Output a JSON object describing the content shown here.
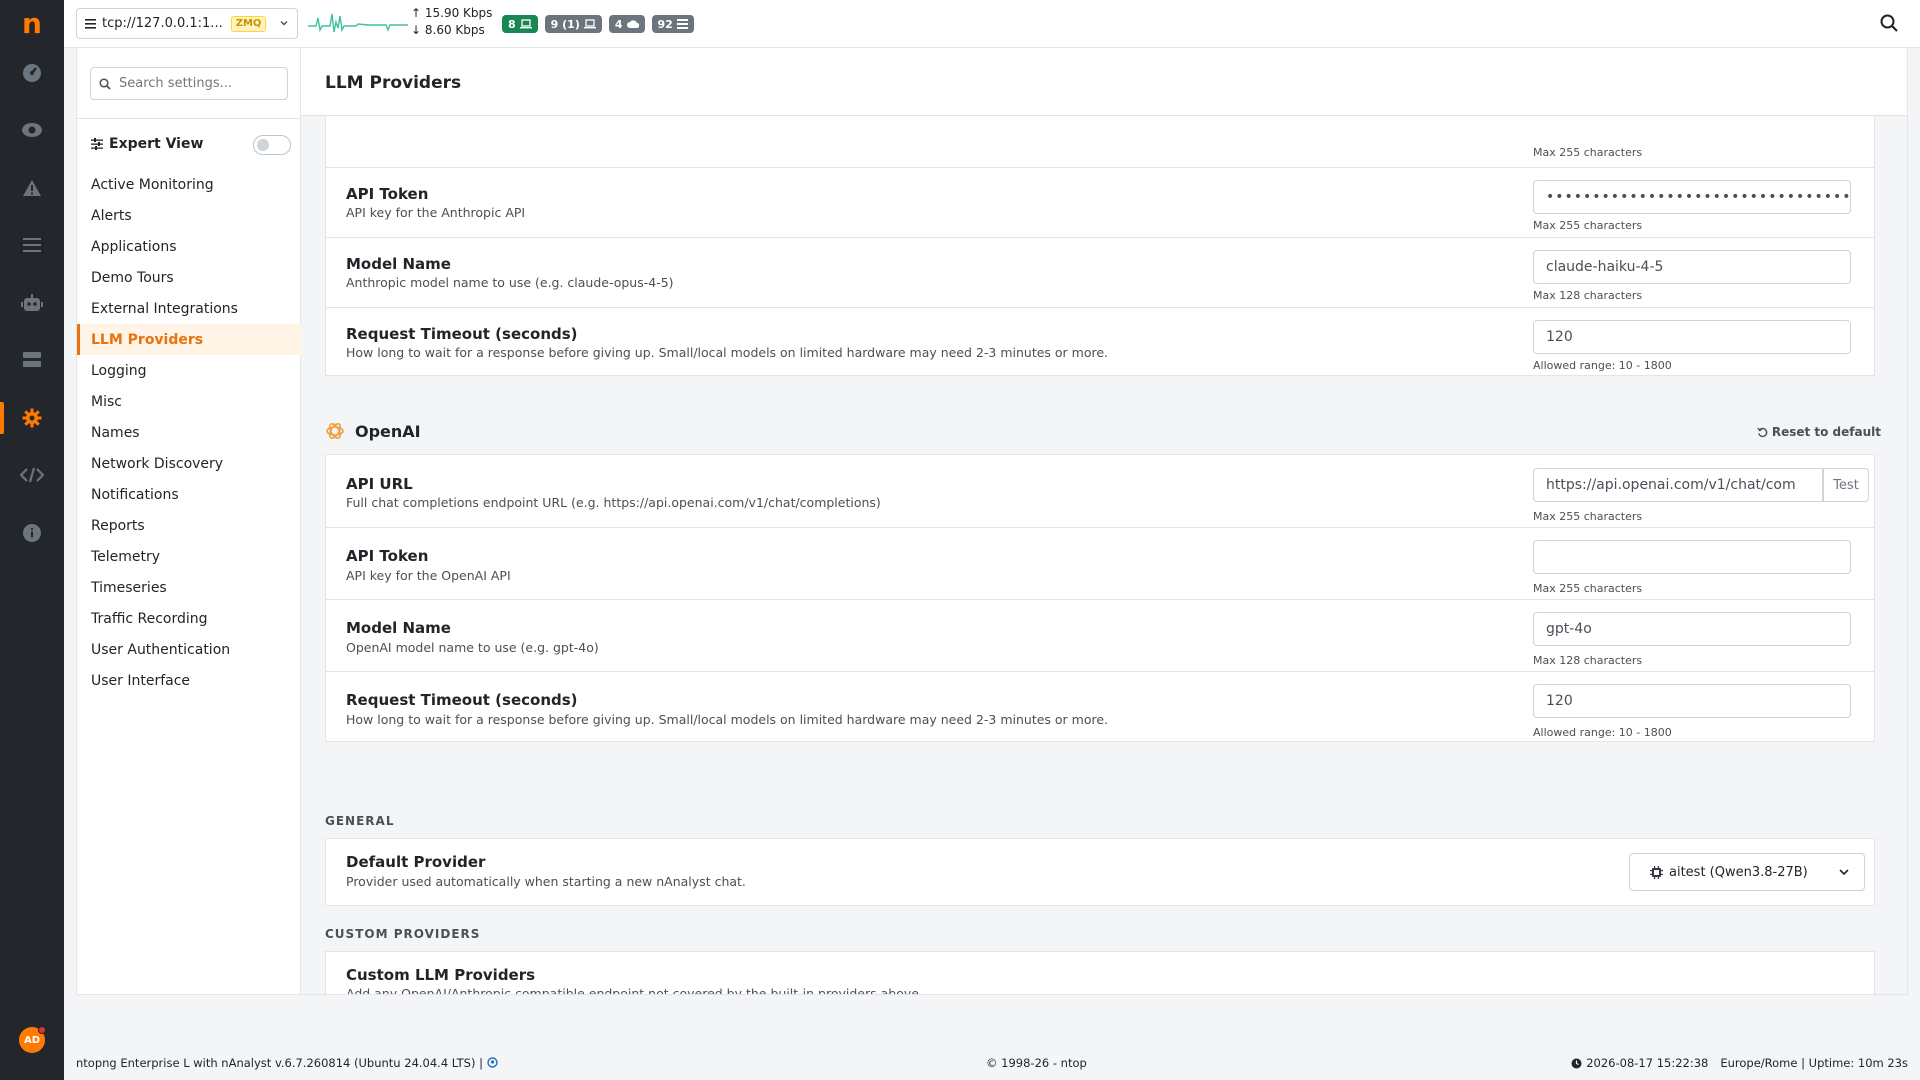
{
  "app": {
    "logo": "n"
  },
  "rail": {
    "items": [
      {
        "name": "dashboard-icon"
      },
      {
        "name": "eye-icon"
      },
      {
        "name": "alert-triangle-icon"
      },
      {
        "name": "list-icon"
      },
      {
        "name": "robot-icon"
      },
      {
        "name": "server-icon"
      },
      {
        "name": "gear-icon"
      },
      {
        "name": "code-icon"
      },
      {
        "name": "info-icon"
      }
    ],
    "avatar": "AD"
  },
  "topbar": {
    "interface": "tcp://127.0.0.1:1...",
    "interface_tag": "ZMQ",
    "upload_rate": "15.90 Kbps",
    "download_rate": "8.60 Kbps",
    "badges": [
      "8",
      "9 (1)",
      "4",
      "92"
    ]
  },
  "sidebar": {
    "search_placeholder": "Search settings...",
    "expert_view": "Expert View",
    "items": [
      "Active Monitoring",
      "Alerts",
      "Applications",
      "Demo Tours",
      "External Integrations",
      "LLM Providers",
      "Logging",
      "Misc",
      "Names",
      "Network Discovery",
      "Notifications",
      "Reports",
      "Telemetry",
      "Timeseries",
      "Traffic Recording",
      "User Authentication",
      "User Interface"
    ],
    "active": "LLM Providers"
  },
  "page": {
    "title": "LLM Providers"
  },
  "anthropic": {
    "prev_hint": "Max 255 characters",
    "token": {
      "title": "API Token",
      "desc": "API key for the Anthropic API",
      "value": "••••••••••••••••••••••••••••••••••••••",
      "hint": "Max 255 characters"
    },
    "model": {
      "title": "Model Name",
      "desc": "Anthropic model name to use (e.g. claude-opus-4-5)",
      "value": "claude-haiku-4-5",
      "hint": "Max 128 characters"
    },
    "timeout": {
      "title": "Request Timeout (seconds)",
      "desc": "How long to wait for a response before giving up. Small/local models on limited hardware may need 2-3 minutes or more.",
      "value": "120",
      "hint": "Allowed range: 10 - 1800"
    }
  },
  "openai": {
    "name": "OpenAI",
    "reset": "Reset to default",
    "url": {
      "title": "API URL",
      "desc": "Full chat completions endpoint URL (e.g. https://api.openai.com/v1/chat/completions)",
      "value": "https://api.openai.com/v1/chat/com",
      "test": "Test",
      "hint": "Max 255 characters"
    },
    "token": {
      "title": "API Token",
      "desc": "API key for the OpenAI API",
      "value": "",
      "hint": "Max 255 characters"
    },
    "model": {
      "title": "Model Name",
      "desc": "OpenAI model name to use (e.g. gpt-4o)",
      "value": "gpt-4o",
      "hint": "Max 128 characters"
    },
    "timeout": {
      "title": "Request Timeout (seconds)",
      "desc": "How long to wait for a response before giving up. Small/local models on limited hardware may need 2-3 minutes or more.",
      "value": "120",
      "hint": "Allowed range: 10 - 1800"
    }
  },
  "general": {
    "caption": "GENERAL",
    "default_provider": {
      "title": "Default Provider",
      "desc": "Provider used automatically when starting a new nAnalyst chat.",
      "value": "aitest (Qwen3.8-27B)"
    }
  },
  "custom": {
    "caption": "CUSTOM PROVIDERS",
    "title": "Custom LLM Providers",
    "desc": "Add any OpenAI/Anthropic compatible endpoint not covered by the built-in providers above."
  },
  "footer": {
    "version": "ntopng Enterprise L with nAnalyst v.6.7.260814 (Ubuntu 24.04.4 LTS) |",
    "copyright": "© 1998-26 - ntop",
    "datetime": "2026-08-17 15:22:38",
    "timezone": "Europe/Rome | Uptime: 10m 23s"
  },
  "colors": {
    "accent": "#ff7a00",
    "rail": "#23272b",
    "badge_green": "#198754",
    "badge_grey": "#6c757d"
  }
}
